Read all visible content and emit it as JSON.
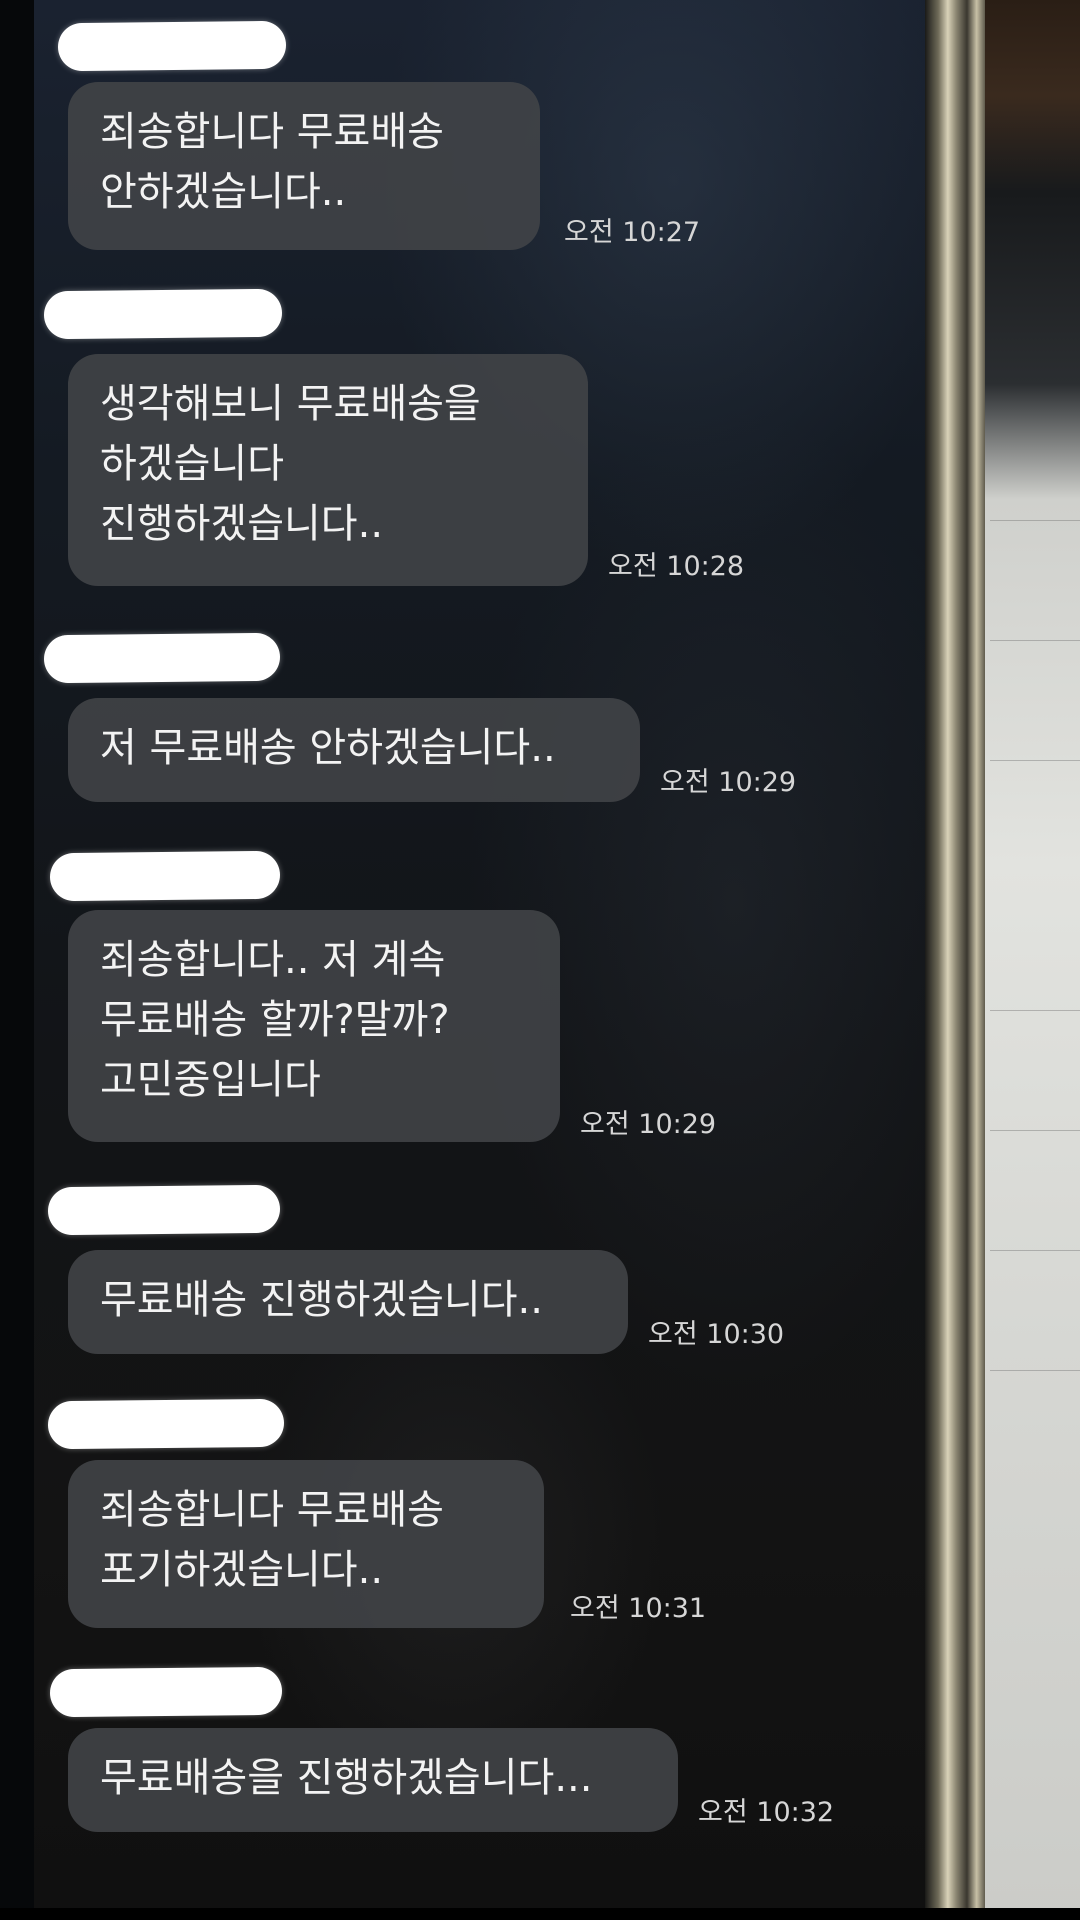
{
  "messages": [
    {
      "text": "죄송합니다 무료배송\n안하겠습니다..",
      "time": "오전 10:27"
    },
    {
      "text": "생각해보니 무료배송을\n하겠습니다\n진행하겠습니다..",
      "time": "오전 10:28"
    },
    {
      "text": "저 무료배송 안하겠습니다..",
      "time": "오전 10:29"
    },
    {
      "text": "죄송합니다.. 저 계속\n무료배송 할까?말까?\n고민중입니다",
      "time": "오전 10:29"
    },
    {
      "text": "무료배송 진행하겠습니다..",
      "time": "오전 10:30"
    },
    {
      "text": "죄송합니다 무료배송\n포기하겠습니다..",
      "time": "오전 10:31"
    },
    {
      "text": "무료배송을 진행하겠습니다...",
      "time": "오전 10:32"
    }
  ],
  "colors": {
    "bubble": "#424448",
    "text": "#f3f3f3",
    "time": "#d6d6d6",
    "redaction": "#ffffff"
  }
}
